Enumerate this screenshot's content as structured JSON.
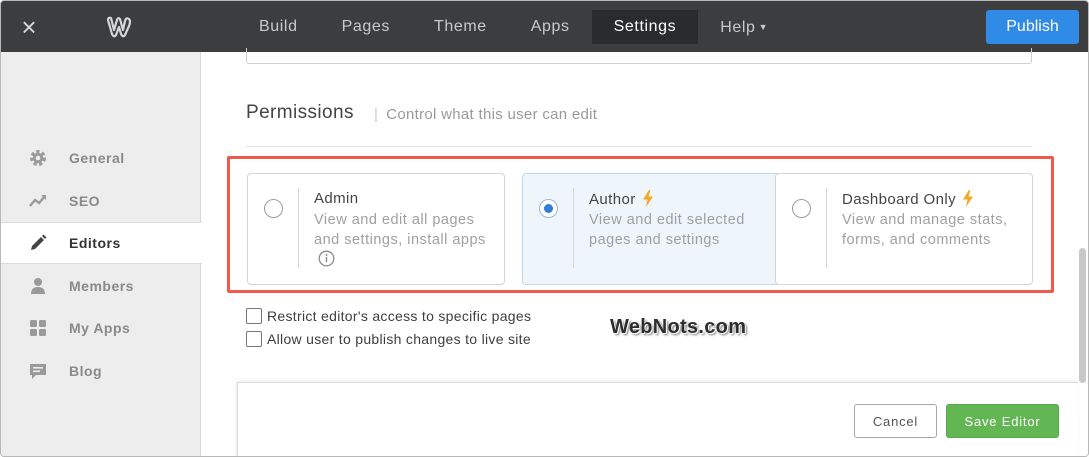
{
  "topbar": {
    "close_icon": "close-icon",
    "logo_icon": "weebly-logo-icon",
    "nav": [
      {
        "label": "Build"
      },
      {
        "label": "Pages"
      },
      {
        "label": "Theme"
      },
      {
        "label": "Apps"
      },
      {
        "label": "Settings"
      },
      {
        "label": "Help"
      }
    ],
    "active_nav": "Settings",
    "publish_label": "Publish",
    "publish_color": "#2f8be6"
  },
  "sidebar": {
    "items": [
      {
        "label": "General",
        "icon": "gear-icon"
      },
      {
        "label": "SEO",
        "icon": "trend-icon"
      },
      {
        "label": "Editors",
        "icon": "pencil-icon"
      },
      {
        "label": "Members",
        "icon": "person-icon"
      },
      {
        "label": "My Apps",
        "icon": "apps-grid-icon"
      },
      {
        "label": "Blog",
        "icon": "comment-icon"
      }
    ],
    "active_item": "Editors"
  },
  "permissions": {
    "title": "Permissions",
    "subtitle": "Control what this user can edit",
    "options": [
      {
        "title": "Admin",
        "desc": "View and edit all pages and settings, install apps",
        "selected": false,
        "premium": false
      },
      {
        "title": "Author",
        "desc": "View and edit selected pages and settings",
        "selected": true,
        "premium": true
      },
      {
        "title": "Dashboard Only",
        "desc": "View and manage stats, forms, and comments",
        "selected": false,
        "premium": true
      }
    ],
    "highlight_color": "#ee5a4c",
    "bolt_color": "#f5a623"
  },
  "checkboxes": [
    {
      "label": "Restrict editor's access to specific pages",
      "checked": false
    },
    {
      "label": "Allow user to publish changes to live site",
      "checked": false
    }
  ],
  "watermark": "WebNots.com",
  "footer": {
    "cancel_label": "Cancel",
    "save_label": "Save Editor",
    "save_color": "#62b653"
  }
}
